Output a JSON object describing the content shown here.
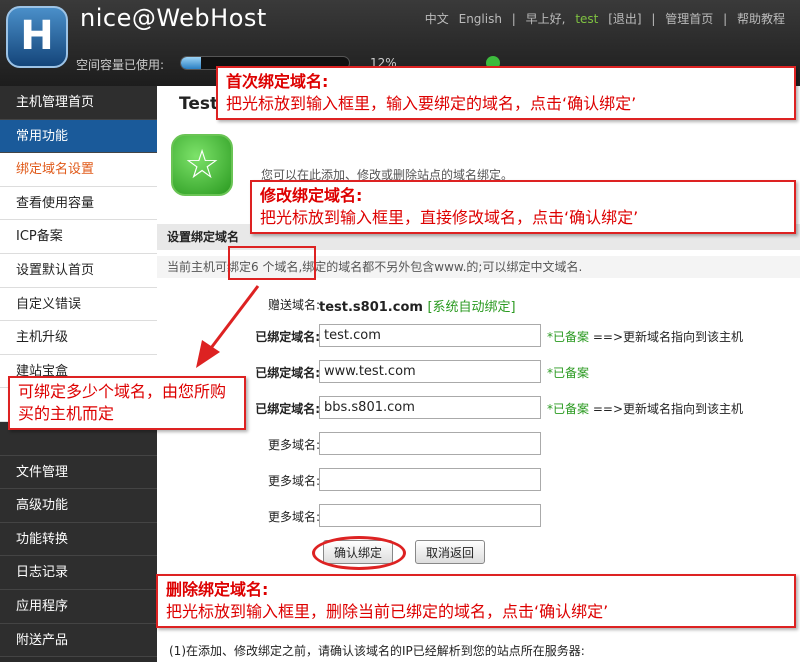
{
  "header": {
    "logo_letter": "H",
    "brand": "nice@WebHost",
    "nav": [
      "中文",
      "English",
      "|",
      "早上好,",
      "test",
      "[退出]",
      "|",
      "管理首页",
      "|",
      "帮助教程"
    ],
    "usage_label": "空间容量已使用:",
    "usage_fraction": 0.12,
    "usage_pct": "12%",
    "colors": {
      "usage_fill": "#2a7fc4",
      "status": "#3dbb3d"
    }
  },
  "sidebar": {
    "items": [
      {
        "label": "主机管理首页",
        "type": "top"
      },
      {
        "label": "常用功能",
        "type": "active"
      },
      {
        "label": "绑定域名设置",
        "type": "sub-current"
      },
      {
        "label": "查看使用容量",
        "type": "sub"
      },
      {
        "label": "ICP备案",
        "type": "sub"
      },
      {
        "label": "设置默认首页",
        "type": "sub"
      },
      {
        "label": "自定义错误",
        "type": "sub"
      },
      {
        "label": "主机升级",
        "type": "sub"
      },
      {
        "label": "建站宝盒",
        "type": "sub"
      },
      {
        "label": "",
        "type": "sub"
      },
      {
        "label": "",
        "type": "top"
      },
      {
        "label": "文件管理",
        "type": "top"
      },
      {
        "label": "高级功能",
        "type": "top"
      },
      {
        "label": "功能转换",
        "type": "top"
      },
      {
        "label": "日志记录",
        "type": "top"
      },
      {
        "label": "应用程序",
        "type": "top"
      },
      {
        "label": "附送产品",
        "type": "top"
      }
    ]
  },
  "main": {
    "title": "Test",
    "intro": "您可以在此添加、修改或删除站点的域名绑定。",
    "section_title": "设置绑定域名",
    "info": "当前主机可绑定6 个域名,绑定的域名都不另外包含www.的;可以绑定中文域名.",
    "gift_label": "赠送域名:",
    "gift_domain": "test.s801.com",
    "gift_tag": "[系统自动绑定]",
    "rows": [
      {
        "label": "已绑定域名:",
        "value": "test.com",
        "note_green": "*已备案",
        "note": "==>更新域名指向到该主机"
      },
      {
        "label": "已绑定域名:",
        "value": "www.test.com",
        "note_green": "*已备案",
        "note": ""
      },
      {
        "label": "已绑定域名:",
        "value": "bbs.s801.com",
        "note_green": "*已备案",
        "note": "==>更新域名指向到该主机"
      },
      {
        "label": "更多域名:",
        "value": "",
        "note_green": "",
        "note": ""
      },
      {
        "label": "更多域名:",
        "value": "",
        "note_green": "",
        "note": ""
      },
      {
        "label": "更多域名:",
        "value": "",
        "note_green": "",
        "note": ""
      }
    ],
    "confirm_button": "确认绑定",
    "cancel_button": "取消返回",
    "footnote": "(1)在添加、修改绑定之前，请确认该域名的IP已经解析到您的站点所在服务器:"
  },
  "callouts": {
    "first": {
      "title": "首次绑定域名:",
      "body": "把光标放到输入框里，输入要绑定的域名，点击‘确认绑定’"
    },
    "modify": {
      "title": "修改绑定域名:",
      "body": "把光标放到输入框里，直接修改域名，点击‘确认绑定’"
    },
    "count": {
      "body": "可绑定多少个域名，由您所购买的主机而定"
    },
    "delete": {
      "title": "删除绑定域名:",
      "body": "把光标放到输入框里，删除当前已绑定的域名，点击‘确认绑定’"
    }
  }
}
